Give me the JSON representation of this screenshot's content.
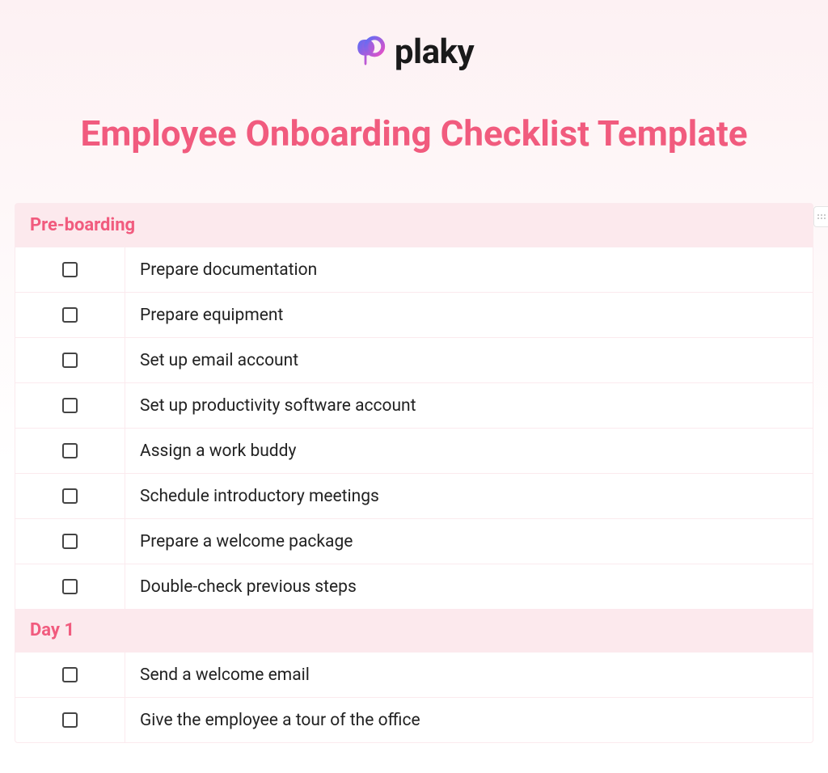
{
  "brand": {
    "name": "plaky"
  },
  "title": "Employee Onboarding Checklist Template",
  "sections": [
    {
      "name": "Pre-boarding",
      "items": [
        "Prepare documentation",
        "Prepare equipment",
        "Set up email account",
        "Set up productivity software account",
        "Assign a work buddy",
        "Schedule introductory meetings",
        "Prepare a welcome package",
        "Double-check previous steps"
      ]
    },
    {
      "name": "Day 1",
      "items": [
        "Send a welcome email",
        "Give the employee a tour of the office"
      ]
    }
  ]
}
